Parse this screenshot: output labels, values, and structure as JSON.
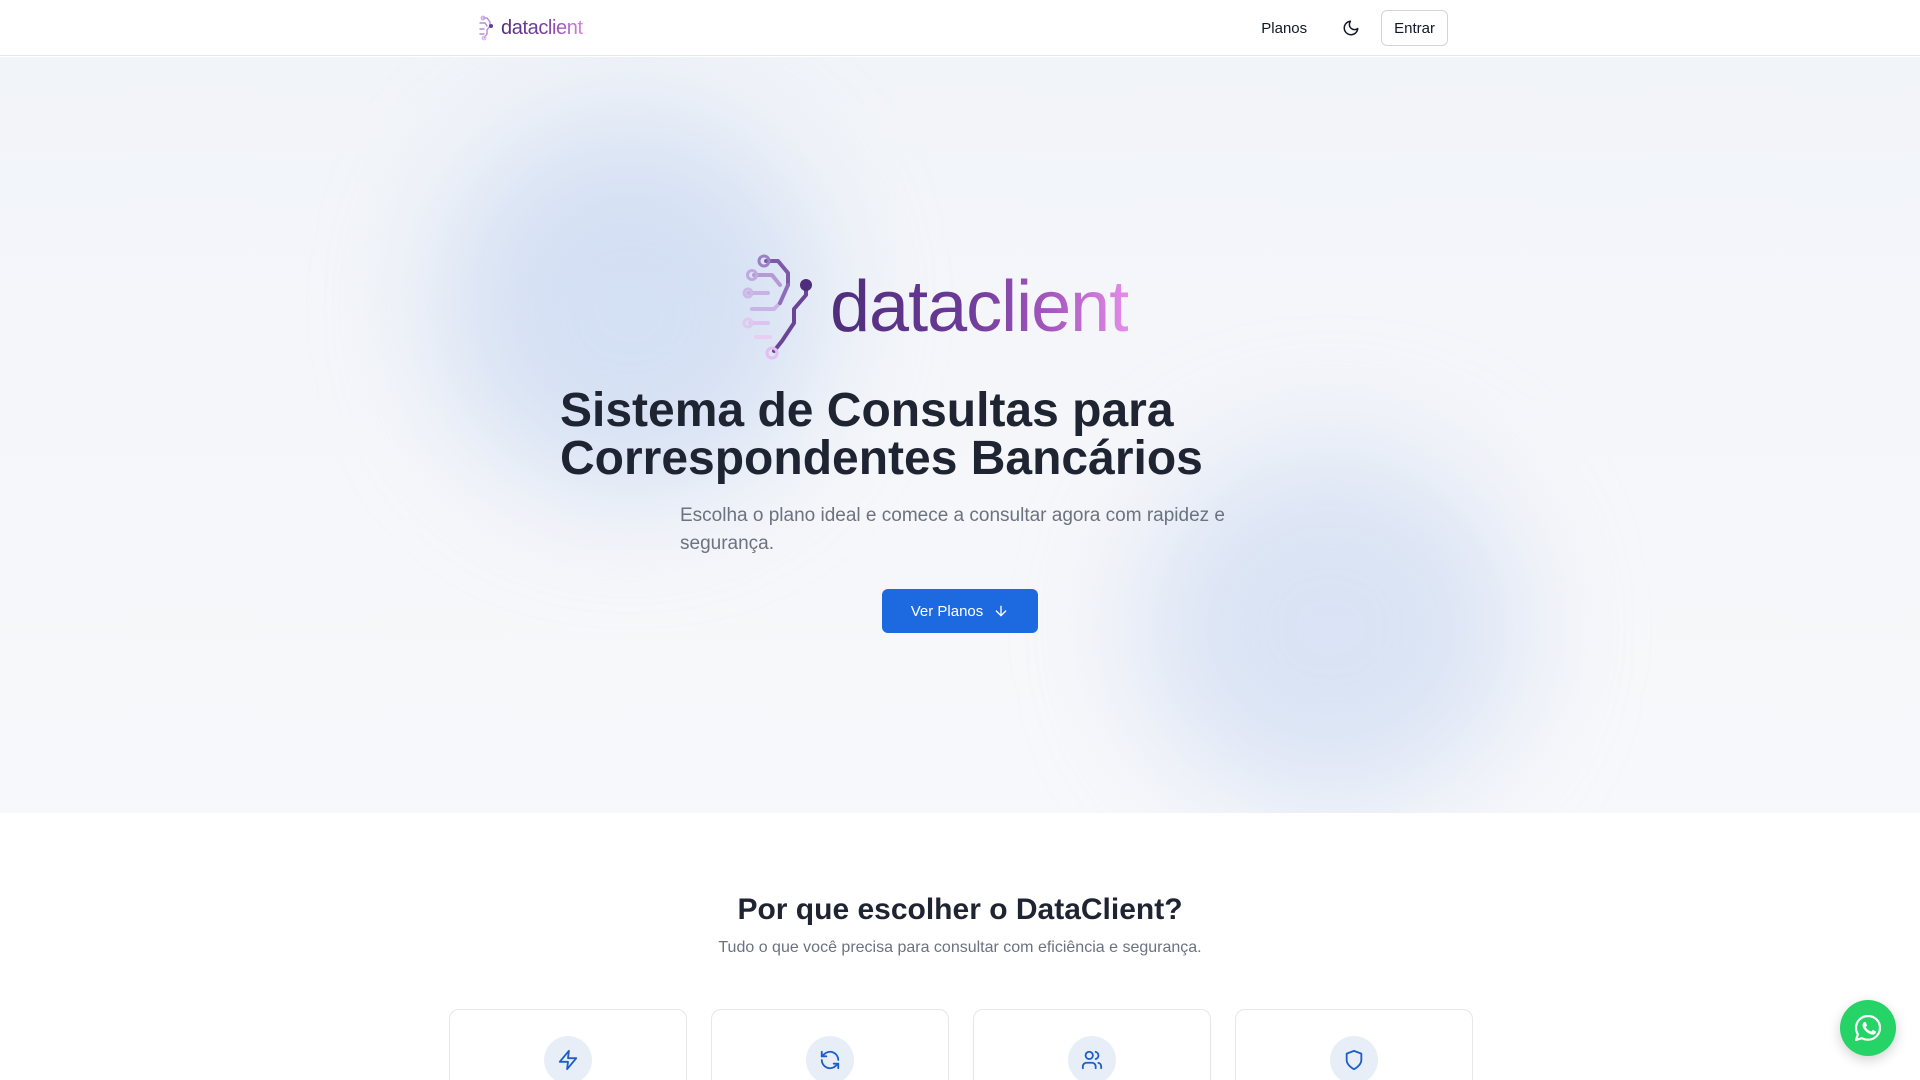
{
  "header": {
    "logo_text": "dataclient",
    "nav_plans": "Planos",
    "theme_toggle_icon": "moon-icon",
    "login_label": "Entrar"
  },
  "hero": {
    "logo_text": "dataclient",
    "title_line1": "Sistema de Consultas para",
    "title_line2": "Correspondentes Bancários",
    "subtitle_line1": "Escolha o plano ideal e comece a consultar agora com rapidez e",
    "subtitle_line2": "segurança.",
    "cta_label": "Ver Planos",
    "cta_icon": "arrow-down-icon"
  },
  "features": {
    "title": "Por que escolher o DataClient?",
    "subtitle": "Tudo o que você precisa para consultar com eficiência e segurança.",
    "cards": [
      {
        "icon": "lightning-icon"
      },
      {
        "icon": "refresh-icon"
      },
      {
        "icon": "users-icon"
      },
      {
        "icon": "shield-icon"
      }
    ]
  },
  "floating": {
    "whatsapp_icon": "whatsapp-icon"
  },
  "colors": {
    "primary": "#1d6ae0",
    "logo_start": "#4e2d7a",
    "logo_end": "#e58ce9",
    "whatsapp": "#25d366",
    "icon_bg": "#e8eef8"
  }
}
